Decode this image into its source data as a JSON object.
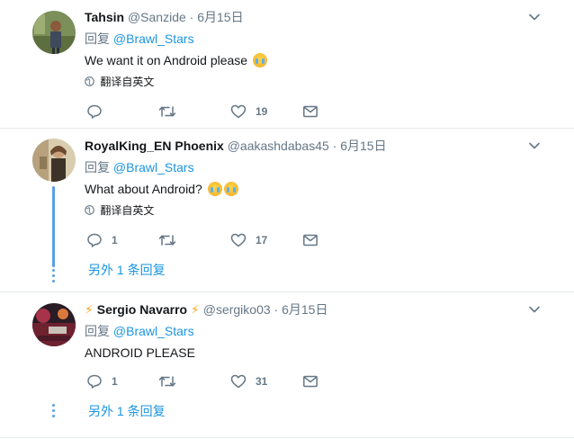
{
  "tweets": [
    {
      "name": "Tahsin",
      "handle": "@Sanzide",
      "date": "· 6月15日",
      "reply_prefix": "回复",
      "reply_to": "@Brawl_Stars",
      "text": "We want it on Android please",
      "translate": "翻译自英文",
      "replies": "",
      "retweets": "",
      "likes": "19"
    },
    {
      "name": "RoyalKing_EN Phoenix",
      "handle": "@aakashdabas45",
      "date": "· 6月15日",
      "reply_prefix": "回复",
      "reply_to": "@Brawl_Stars",
      "text": "What about Android?",
      "translate": "翻译自英文",
      "replies": "1",
      "retweets": "",
      "likes": "17",
      "more_replies": "另外 1 条回复"
    },
    {
      "name": "Sergio Navarro",
      "name_prefix_emoji": "⚡",
      "name_suffix_emoji": "⚡",
      "handle": "@sergiko03",
      "date": "· 6月15日",
      "reply_prefix": "回复",
      "reply_to": "@Brawl_Stars",
      "text": "ANDROID PLEASE",
      "replies": "1",
      "retweets": "",
      "likes": "31",
      "more_replies": "另外 1 条回复"
    }
  ],
  "colors": {
    "link": "#1b95e0",
    "muted": "#657786",
    "thread": "#5aa0e0",
    "separator": "#e6ecf0"
  },
  "icons": [
    "reply-icon",
    "retweet-icon",
    "like-icon",
    "message-icon",
    "globe-icon",
    "chevron-down-icon",
    "sob-emoji"
  ]
}
